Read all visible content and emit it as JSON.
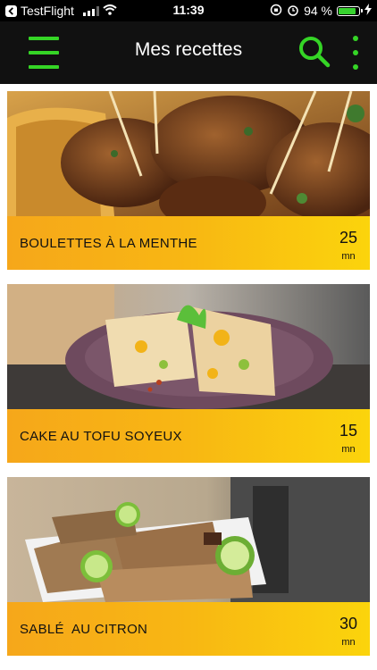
{
  "status_bar": {
    "carrier": "TestFlight",
    "time": "11:39",
    "battery": "94 %",
    "battery_level": 0.94
  },
  "header": {
    "title": "Mes recettes",
    "accent_color": "#35d526"
  },
  "recipes": [
    {
      "title": "BOULETTES À LA MENTHE",
      "duration": "25",
      "unit": "mn"
    },
    {
      "title": "CAKE AU TOFU SOYEUX",
      "duration": "15",
      "unit": "mn"
    },
    {
      "title": "SABLÉ  AU CITRON",
      "duration": "30",
      "unit": "mn"
    }
  ],
  "band_colors": [
    "#f6a71a",
    "#fbd40c"
  ]
}
